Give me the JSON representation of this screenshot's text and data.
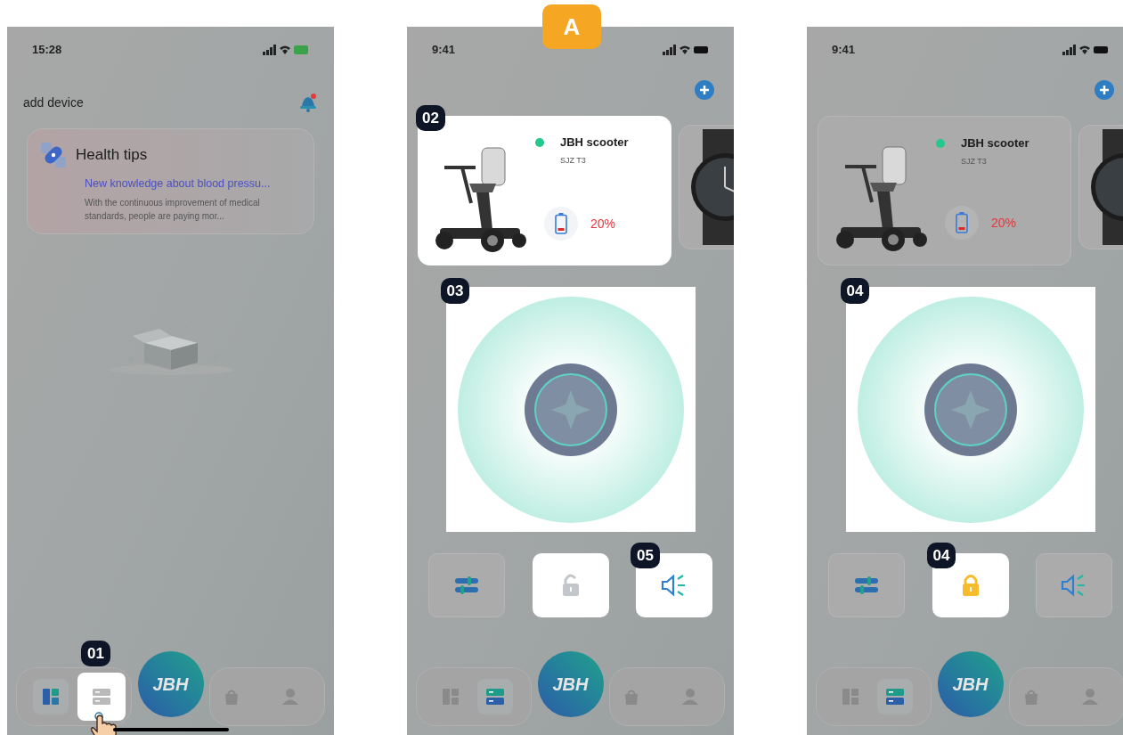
{
  "step_badge": "A",
  "screens": [
    {
      "kind": "home",
      "time": "15:28",
      "header": "add device",
      "tip": {
        "title": "Health tips",
        "link": "New knowledge about blood pressu...",
        "body": "With the continuous improvement of medical standards, people are paying mor..."
      },
      "nav": {
        "logo": "JBH",
        "home_indicator": true,
        "tabs": [
          {
            "kind": "dashboard",
            "selected": true,
            "highlighted": false
          },
          {
            "kind": "devices",
            "selected": false,
            "highlighted": true,
            "callout": "01",
            "pointer": true
          },
          {
            "kind": "shop",
            "selected": false,
            "highlighted": false
          },
          {
            "kind": "profile",
            "selected": false,
            "highlighted": false
          }
        ]
      }
    },
    {
      "kind": "device",
      "time": "9:41",
      "device": {
        "name": "JBH scooter",
        "model": "SJZ T3",
        "online": true,
        "battery": "20%",
        "highlighted": true,
        "callout": "02"
      },
      "dial": {
        "highlighted": true,
        "callout": "03"
      },
      "controls": [
        {
          "kind": "settings",
          "highlighted": false
        },
        {
          "kind": "lock",
          "locked": false,
          "highlighted": true
        },
        {
          "kind": "sound",
          "highlighted": true,
          "callout": "05"
        }
      ],
      "nav": {
        "logo": "JBH",
        "tabs": [
          {
            "kind": "dashboard",
            "selected": false,
            "highlighted": false
          },
          {
            "kind": "devices",
            "selected": true,
            "highlighted": false
          },
          {
            "kind": "shop",
            "selected": false,
            "highlighted": false
          },
          {
            "kind": "profile",
            "selected": false,
            "highlighted": false
          }
        ]
      }
    },
    {
      "kind": "device",
      "time": "9:41",
      "device": {
        "name": "JBH scooter",
        "model": "SJZ T3",
        "online": true,
        "battery": "20%",
        "highlighted": false
      },
      "dial": {
        "highlighted": true,
        "callout": "04"
      },
      "controls": [
        {
          "kind": "settings",
          "highlighted": false
        },
        {
          "kind": "lock",
          "locked": true,
          "highlighted": true,
          "callout": "04"
        },
        {
          "kind": "sound",
          "highlighted": false
        }
      ],
      "nav": {
        "logo": "JBH",
        "tabs": [
          {
            "kind": "dashboard",
            "selected": false,
            "highlighted": false
          },
          {
            "kind": "devices",
            "selected": true,
            "highlighted": false
          },
          {
            "kind": "shop",
            "selected": false,
            "highlighted": false
          },
          {
            "kind": "profile",
            "selected": false,
            "highlighted": false
          }
        ]
      }
    }
  ]
}
